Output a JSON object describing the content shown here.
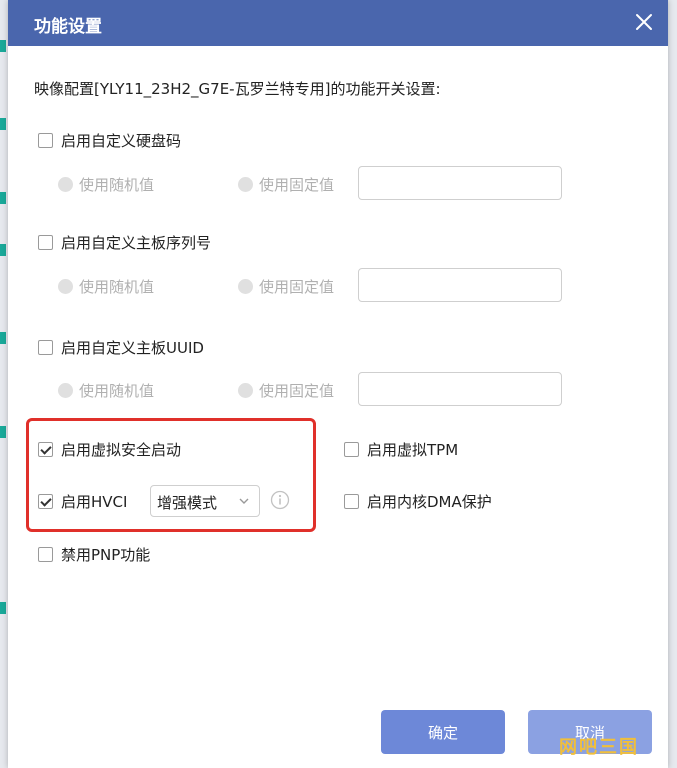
{
  "dialog": {
    "title": "功能设置",
    "description": "映像配置[YLY11_23H2_G7E-瓦罗兰特专用]的功能开关设置:",
    "sections": [
      {
        "label": "启用自定义硬盘码",
        "checked": false,
        "random_label": "使用随机值",
        "fixed_label": "使用固定值",
        "value": ""
      },
      {
        "label": "启用自定义主板序列号",
        "checked": false,
        "random_label": "使用随机值",
        "fixed_label": "使用固定值",
        "value": ""
      },
      {
        "label": "启用自定义主板UUID",
        "checked": false,
        "random_label": "使用随机值",
        "fixed_label": "使用固定值",
        "value": ""
      }
    ],
    "options": {
      "virtual_secure_boot": {
        "label": "启用虚拟安全启动",
        "checked": true
      },
      "virtual_tpm": {
        "label": "启用虚拟TPM",
        "checked": false
      },
      "hvci": {
        "label": "启用HVCI",
        "checked": true,
        "mode": "增强模式"
      },
      "kernel_dma": {
        "label": "启用内核DMA保护",
        "checked": false
      },
      "disable_pnp": {
        "label": "禁用PNP功能",
        "checked": false
      }
    },
    "ok_label": "确定",
    "cancel_label": "取消"
  },
  "watermark": "网吧三国",
  "colors": {
    "titlebar": "#4a66ad",
    "highlight_border": "#e0302a",
    "ok_button": "#6d88d8",
    "cancel_button": "#8ba1e2"
  }
}
